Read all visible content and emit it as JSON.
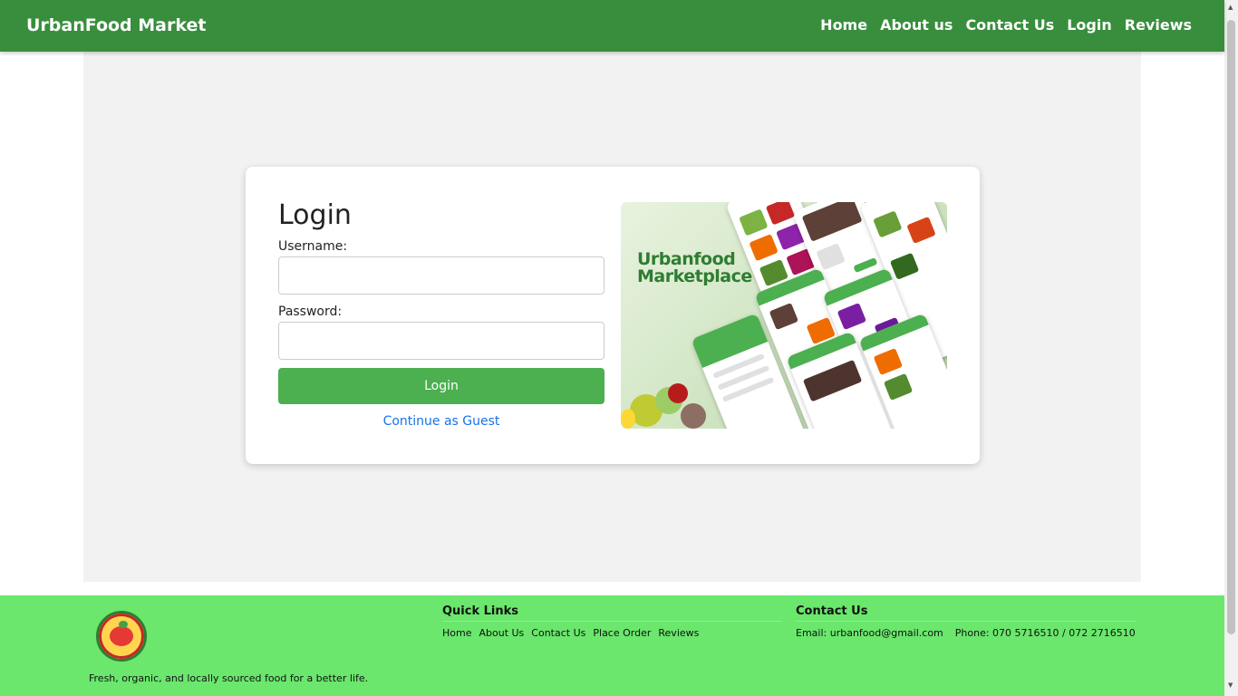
{
  "header": {
    "brand": "UrbanFood Market",
    "nav": [
      "Home",
      "About us",
      "Contact Us",
      "Login",
      "Reviews"
    ]
  },
  "login": {
    "title": "Login",
    "username_label": "Username:",
    "username_value": "",
    "password_label": "Password:",
    "password_value": "",
    "submit_label": "Login",
    "guest_link": "Continue as Guest"
  },
  "promo": {
    "title_line1": "Urbanfood",
    "title_line2": "Marketplace"
  },
  "footer": {
    "tagline": "Fresh, organic, and locally sourced food for a better life.",
    "quick_links": {
      "heading": "Quick Links",
      "items": [
        "Home",
        "About Us",
        "Contact Us",
        "Place Order",
        "Reviews"
      ]
    },
    "contact": {
      "heading": "Contact Us",
      "email": "Email: urbanfood@gmail.com",
      "phone": "Phone: 070 5716510 / 072 2716510"
    }
  },
  "colors": {
    "header_bg": "#388e3c",
    "button_green": "#4caf50",
    "footer_bg": "#6ae76c",
    "link_blue": "#1a73e8",
    "main_bg": "#f2f2f2"
  },
  "icons": {
    "footer_logo": "urbanfood-logo-icon",
    "scroll_up": "chevron-up-icon",
    "scroll_down": "chevron-down-icon"
  }
}
